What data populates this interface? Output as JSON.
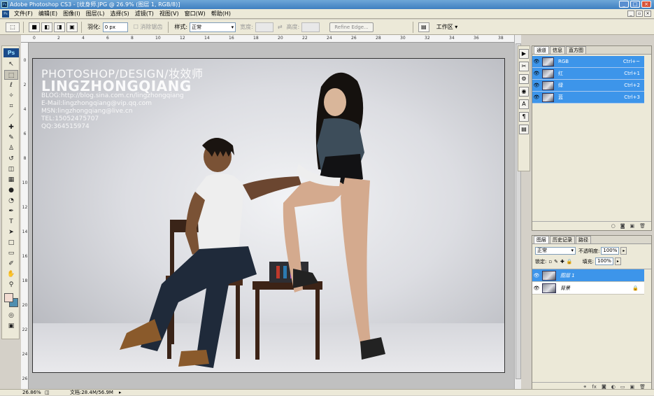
{
  "window": {
    "title": "Adobe Photoshop CS3 - [纹身师.JPG @ 26.9% (图层 1, RGB/8)]",
    "app_logo": "Ps",
    "minimize_label": "_",
    "maximize_label": "□",
    "close_label": "×"
  },
  "menu": {
    "items": [
      "文件(F)",
      "编辑(E)",
      "图像(I)",
      "图层(L)",
      "选择(S)",
      "滤镜(T)",
      "视图(V)",
      "窗口(W)",
      "帮助(H)"
    ],
    "doc_buttons": [
      "_",
      "▫",
      "×"
    ]
  },
  "options": {
    "feather_label": "羽化:",
    "feather_value": "0 px",
    "antialias_label": "消除锯齿",
    "style_label": "样式:",
    "style_value": "正常",
    "width_label": "宽度:",
    "height_label": "高度:",
    "refine_edge_label": "Refine Edge...",
    "workspace_label": "工作区 ▾"
  },
  "rulers": {
    "top": [
      "0",
      "2",
      "4",
      "6",
      "8",
      "10",
      "12",
      "14",
      "16",
      "18",
      "20",
      "22",
      "24",
      "26",
      "28",
      "30",
      "32",
      "34",
      "36",
      "38"
    ],
    "left": [
      "0",
      "2",
      "4",
      "6",
      "8",
      "10",
      "12",
      "14",
      "16",
      "18",
      "20",
      "22",
      "24",
      "26"
    ]
  },
  "toolbox": {
    "logo": "Ps",
    "tools": [
      {
        "name": "move-tool",
        "glyph": "↖"
      },
      {
        "name": "marquee-tool",
        "glyph": "⬚"
      },
      {
        "name": "lasso-tool",
        "glyph": "ℓ"
      },
      {
        "name": "magic-wand-tool",
        "glyph": "✧"
      },
      {
        "name": "crop-tool",
        "glyph": "⌗"
      },
      {
        "name": "slice-tool",
        "glyph": "⟋"
      },
      {
        "name": "healing-brush-tool",
        "glyph": "✚"
      },
      {
        "name": "brush-tool",
        "glyph": "✎"
      },
      {
        "name": "clone-stamp-tool",
        "glyph": "♙"
      },
      {
        "name": "history-brush-tool",
        "glyph": "↺"
      },
      {
        "name": "eraser-tool",
        "glyph": "◫"
      },
      {
        "name": "gradient-tool",
        "glyph": "▦"
      },
      {
        "name": "blur-tool",
        "glyph": "●"
      },
      {
        "name": "dodge-tool",
        "glyph": "◔"
      },
      {
        "name": "pen-tool",
        "glyph": "✒"
      },
      {
        "name": "type-tool",
        "glyph": "T"
      },
      {
        "name": "path-selection-tool",
        "glyph": "➤"
      },
      {
        "name": "shape-tool",
        "glyph": "□"
      },
      {
        "name": "notes-tool",
        "glyph": "▭"
      },
      {
        "name": "eyedropper-tool",
        "glyph": "✐"
      },
      {
        "name": "hand-tool",
        "glyph": "✋"
      },
      {
        "name": "zoom-tool",
        "glyph": "⚲"
      }
    ]
  },
  "watermark": {
    "line1": "PHOTOSHOP/DESIGN/妆效师",
    "line2": "LINGZHONGQIANG",
    "blog": "BLOG:http://blog.sina.com.cn/lingzhongqiang",
    "email": "E-Mail:lingzhongqiang@vip.qq.com",
    "msn": "MSN:lingzhongqiang@live.cn",
    "tel": "TEL:15052475707",
    "qq": "QQ:364515974"
  },
  "channels_panel": {
    "tabs": [
      "通道",
      "信息",
      "直方图"
    ],
    "rows": [
      {
        "name": "RGB",
        "shortcut": "Ctrl+~"
      },
      {
        "name": "红",
        "shortcut": "Ctrl+1"
      },
      {
        "name": "绿",
        "shortcut": "Ctrl+2"
      },
      {
        "name": "蓝",
        "shortcut": "Ctrl+3"
      }
    ],
    "footer_icons": [
      "○",
      "◙",
      "▣",
      "🗑"
    ]
  },
  "layers_panel": {
    "tabs": [
      "图层",
      "历史记录",
      "路径"
    ],
    "blend_mode": "正常",
    "opacity_label": "不透明度:",
    "opacity_value": "100%",
    "lock_label": "锁定:",
    "fill_label": "填充:",
    "fill_value": "100%",
    "layers": [
      {
        "name": "图层 1",
        "selected": true
      },
      {
        "name": "背景",
        "selected": false,
        "locked": true
      }
    ],
    "footer_icons": [
      "⚭",
      "fx",
      "◙",
      "◐",
      "▭",
      "▣",
      "🗑"
    ]
  },
  "status": {
    "zoom": "26.86%",
    "doc_info": "文档:28.4M/56.9M"
  }
}
